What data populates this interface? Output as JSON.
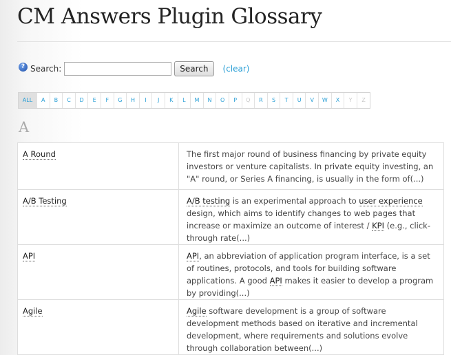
{
  "title": "CM Answers Plugin Glossary",
  "search": {
    "help_icon": "?",
    "label": "Search:",
    "value": "",
    "placeholder": "",
    "button": "Search",
    "clear": "(clear)"
  },
  "letters": [
    {
      "label": "ALL",
      "state": "active"
    },
    {
      "label": "A",
      "state": "enabled"
    },
    {
      "label": "B",
      "state": "enabled"
    },
    {
      "label": "C",
      "state": "enabled"
    },
    {
      "label": "D",
      "state": "enabled"
    },
    {
      "label": "E",
      "state": "enabled"
    },
    {
      "label": "F",
      "state": "enabled"
    },
    {
      "label": "G",
      "state": "enabled"
    },
    {
      "label": "H",
      "state": "enabled"
    },
    {
      "label": "I",
      "state": "enabled"
    },
    {
      "label": "J",
      "state": "enabled"
    },
    {
      "label": "K",
      "state": "enabled"
    },
    {
      "label": "L",
      "state": "enabled"
    },
    {
      "label": "M",
      "state": "enabled"
    },
    {
      "label": "N",
      "state": "enabled"
    },
    {
      "label": "O",
      "state": "enabled"
    },
    {
      "label": "P",
      "state": "enabled"
    },
    {
      "label": "Q",
      "state": "disabled"
    },
    {
      "label": "R",
      "state": "enabled"
    },
    {
      "label": "S",
      "state": "enabled"
    },
    {
      "label": "T",
      "state": "enabled"
    },
    {
      "label": "U",
      "state": "enabled"
    },
    {
      "label": "V",
      "state": "enabled"
    },
    {
      "label": "W",
      "state": "enabled"
    },
    {
      "label": "X",
      "state": "enabled"
    },
    {
      "label": "Y",
      "state": "disabled"
    },
    {
      "label": "Z",
      "state": "disabled"
    }
  ],
  "section_letter": "A",
  "terms": [
    {
      "term": "A Round",
      "desc": [
        {
          "t": "The first major round of business financing by private equity investors or venture capitalists. In private equity investing, an \"A\" round, or Series A financing, is usually in the form of(...)"
        }
      ]
    },
    {
      "term": "A/B Testing",
      "desc": [
        {
          "t": "A/B testing",
          "link": true
        },
        {
          "t": " is an experimental approach to "
        },
        {
          "t": "user experience",
          "link": true
        },
        {
          "t": " design, which aims to identify changes to web pages that increase or maximize an outcome of interest / "
        },
        {
          "t": "KPI",
          "link": true
        },
        {
          "t": " (e.g., click-through rate(...)"
        }
      ]
    },
    {
      "term": "API",
      "desc": [
        {
          "t": "API",
          "link": true
        },
        {
          "t": ", an abbreviation of application program interface, is a set of routines, protocols, and tools for building software applications. A good "
        },
        {
          "t": "API",
          "link": true
        },
        {
          "t": " makes it easier to develop a program by providing(...)"
        }
      ]
    },
    {
      "term": "Agile",
      "desc": [
        {
          "t": "Agile",
          "link": true
        },
        {
          "t": " software development is a group of software development methods based on iterative and incremental development, where requirements and solutions evolve through collaboration between(...)"
        }
      ]
    }
  ]
}
